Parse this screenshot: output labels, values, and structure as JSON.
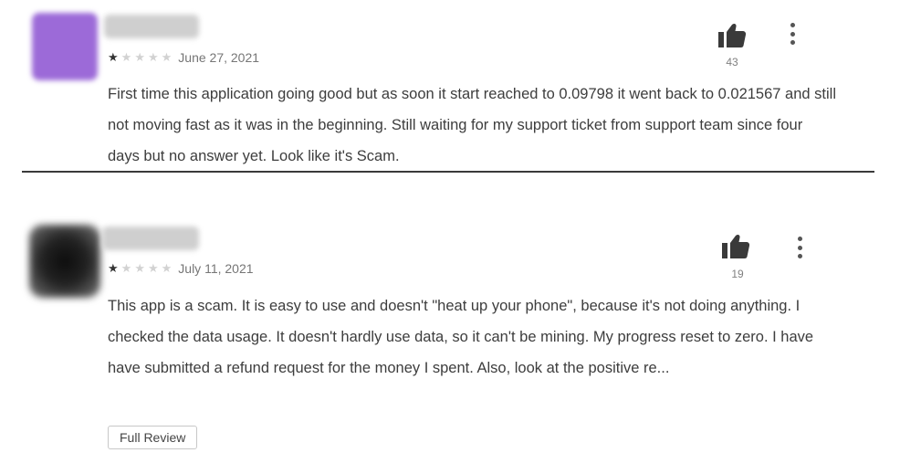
{
  "reviews": [
    {
      "rating": 1,
      "rating_max": 5,
      "date": "June 27, 2021",
      "helpful_count": "43",
      "text": "First time this application going good but as soon it start reached to 0.09798 it went back to 0.021567 and still not moving fast as it was in the beginning. Still waiting for my support ticket from support team since four days but no answer yet. Look like it's Scam.",
      "avatar_color": "#9c6ad8"
    },
    {
      "rating": 1,
      "rating_max": 5,
      "date": "July 11, 2021",
      "helpful_count": "19",
      "text": "This app is a scam. It is easy to use and doesn't \"heat up your phone\", because it's not doing anything. I checked the data usage. It doesn't hardly use data, so it can't be mining. My progress reset to zero. I have have submitted a refund request for the money I spent. Also, look at the positive re...",
      "avatar_color": "#111111",
      "full_review_label": "Full Review"
    }
  ],
  "icons": {
    "helpful": "thumbs-up-icon",
    "more": "more-vert-icon",
    "star": "star-icon"
  }
}
